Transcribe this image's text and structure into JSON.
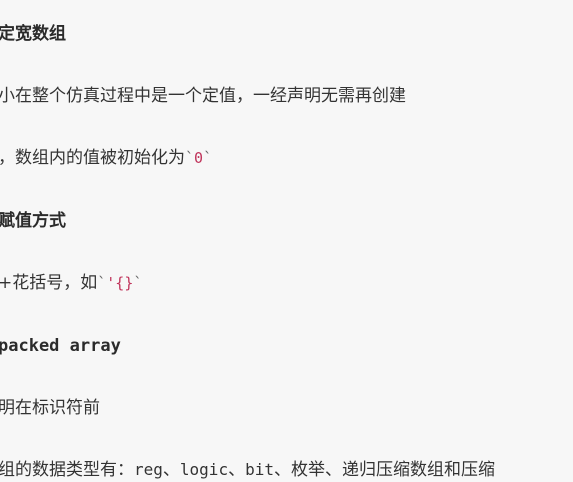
{
  "lines": {
    "h1": "定宽数组",
    "p1": "小在整个仿真过程中是一个定值，一经声明无需再创建",
    "p2_text": "，数组内的值被初始化为",
    "p2_tick_open": "`",
    "p2_code": "0",
    "p2_tick_close": "`",
    "h2": "赋值方式",
    "p3_text": "+花括号，如",
    "p3_tick_open": "`",
    "p3_code": "'{}",
    "p3_tick_close": "`",
    "h3": "packed array",
    "p4": "明在标识符前",
    "p5_text1": "组的数据类型有：",
    "p5_code1": "reg",
    "p5_sep1": "、",
    "p5_code2": "logic",
    "p5_sep2": "、",
    "p5_code3": "bit",
    "p5_text2": "、枚举、递归压缩数组和压缩"
  }
}
